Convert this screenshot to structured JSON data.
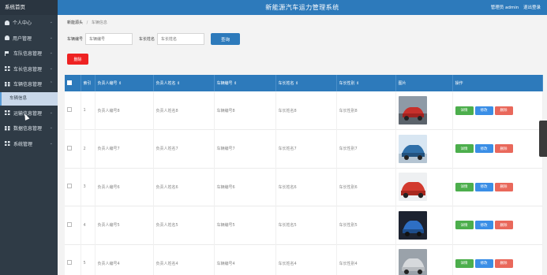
{
  "sidebar": {
    "logo": "系统首页",
    "items": [
      {
        "label": "个人中心",
        "icon": "user-icon",
        "chev": "⌄"
      },
      {
        "label": "用户管理",
        "icon": "user-icon",
        "chev": "⌄"
      },
      {
        "label": "车队信息管理",
        "icon": "flag-icon",
        "chev": "⌄"
      },
      {
        "label": "车长信息管理",
        "icon": "grid-icon",
        "chev": "⌄"
      },
      {
        "label": "车辆信息管理",
        "icon": "grid-icon",
        "chev": "⌃"
      },
      {
        "label": "运输信息管理",
        "icon": "grid-icon",
        "chev": "⌄"
      },
      {
        "label": "数据信息管理",
        "icon": "grid-icon",
        "chev": "⌄"
      },
      {
        "label": "系统管理",
        "icon": "grid-icon",
        "chev": "⌄"
      }
    ],
    "sub_item": "车辆信息"
  },
  "header": {
    "title": "新能源汽车运力管理系统",
    "user": "管理员 admin",
    "logout": "退出登录"
  },
  "breadcrumb": {
    "home": "新能源头",
    "sep": "/",
    "current": "车辆信息"
  },
  "search": {
    "field1_label": "车辆编号",
    "field1_placeholder": "车辆编号",
    "field2_label": "车长姓名",
    "field2_placeholder": "车长姓名",
    "button": "查询"
  },
  "delete_button": "删除",
  "table": {
    "columns": [
      "索引",
      "负责人编号 ⇕",
      "负责人姓名 ⇕",
      "车辆编号 ⇕",
      "车长姓名 ⇕",
      "车长性别 ⇕",
      "图片",
      "操作"
    ],
    "rows": [
      {
        "index": "1",
        "c1": "负责人编号8",
        "c2": "负责人姓名8",
        "c3": "车辆编号8",
        "c4": "车长姓名8",
        "c5": "车长性别8"
      },
      {
        "index": "2",
        "c1": "负责人编号7",
        "c2": "负责人姓名7",
        "c3": "车辆编号7",
        "c4": "车长姓名7",
        "c5": "车长性别7"
      },
      {
        "index": "3",
        "c1": "负责人编号6",
        "c2": "负责人姓名6",
        "c3": "车辆编号6",
        "c4": "车长姓名6",
        "c5": "车长性别6"
      },
      {
        "index": "4",
        "c1": "负责人编号5",
        "c2": "负责人姓名5",
        "c3": "车辆编号5",
        "c4": "车长姓名5",
        "c5": "车长性别5"
      },
      {
        "index": "5",
        "c1": "负责人编号4",
        "c2": "负责人姓名4",
        "c3": "车辆编号4",
        "c4": "车长姓名4",
        "c5": "车长性别4"
      }
    ],
    "actions": {
      "view": "详情",
      "edit": "修改",
      "delete": "删除"
    }
  },
  "colors": {
    "primary": "#2d7abb",
    "sidebar": "#2f3b46",
    "danger": "#ee2222",
    "success": "#4cae4c"
  }
}
